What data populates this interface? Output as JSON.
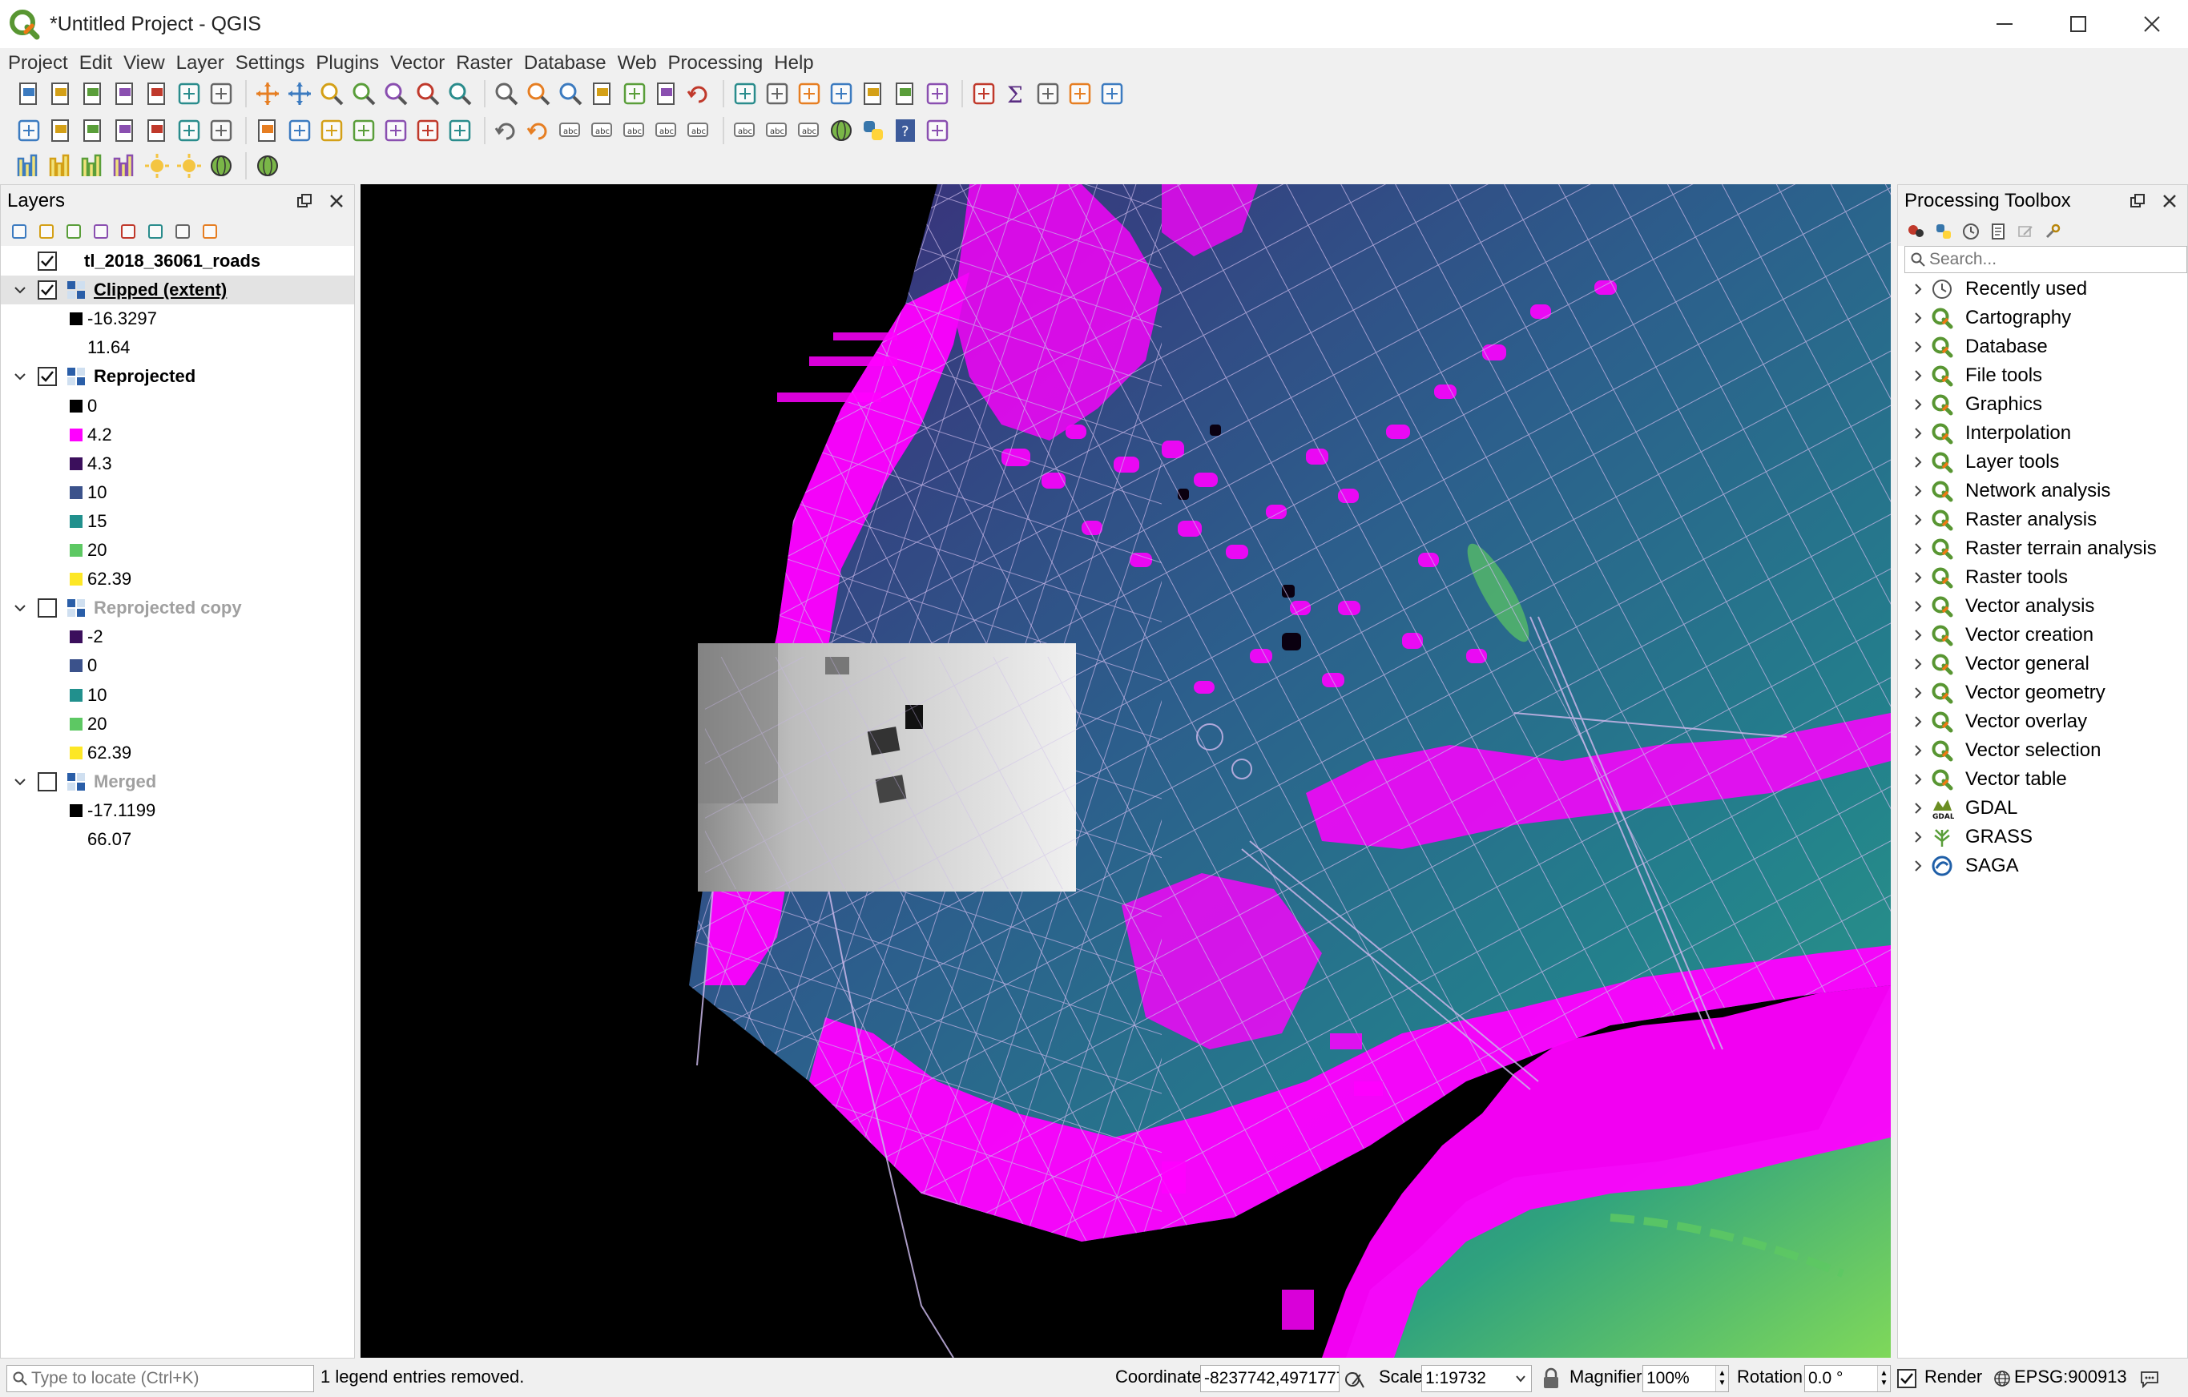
{
  "window": {
    "title": "*Untitled Project - QGIS",
    "controls": [
      "minimize",
      "maximize",
      "close"
    ]
  },
  "menubar": [
    "Project",
    "Edit",
    "View",
    "Layer",
    "Settings",
    "Plugins",
    "Vector",
    "Raster",
    "Database",
    "Web",
    "Processing",
    "Help"
  ],
  "toolbar1": [
    "new-project",
    "open-project",
    "save-project",
    "save-as",
    "new-print-layout",
    "layout-manager",
    "style-manager",
    "pan-map",
    "pan-to-selection",
    "zoom-in",
    "zoom-out",
    "zoom-native",
    "zoom-full",
    "zoom-to-selection",
    "zoom-to-layer",
    "zoom-last",
    "zoom-next",
    "new-bookmark",
    "show-bookmarks",
    "new-map-view",
    "refresh",
    "identify",
    "actions",
    "select-features",
    "deselect",
    "open-attribute-table",
    "open-field-calculator",
    "show-statistical-summary",
    "processing-toolbox",
    "statistics-sigma",
    "measure-line",
    "show-map-tips",
    "text-annotation"
  ],
  "toolbar2": [
    "data-source-manager",
    "new-geopackage",
    "new-shapefile",
    "new-spatialite",
    "new-virtual-layer",
    "current-edits",
    "toggle-editing",
    "save-edits",
    "add-feature",
    "vertex-tool",
    "delete-selected",
    "cut-features",
    "copy-features",
    "paste-features",
    "undo",
    "redo",
    "label-toolbar",
    "layer-labeling",
    "highlight-pinned",
    "pin-labels",
    "show-hide-labels",
    "move-label",
    "rotate-label",
    "change-label",
    "osm-search",
    "python-console",
    "help",
    "georeferencer"
  ],
  "toolbar3": [
    "raster-calc-1",
    "raster-calc-2",
    "raster-calc-3",
    "raster-calc-4",
    "sun-1",
    "sun-2",
    "globe-1",
    "globe-2"
  ],
  "layers_panel": {
    "title": "Layers",
    "items": [
      {
        "type": "layer",
        "name": "tl_2018_36061_roads",
        "checked": true,
        "expandable": false,
        "icon": "vector-line-icon"
      },
      {
        "type": "layer",
        "name": "Clipped (extent)",
        "checked": true,
        "expandable": true,
        "selected": true,
        "underline": true,
        "icon": "raster-icon"
      },
      {
        "type": "class",
        "swatch": "#000000",
        "label": "-16.3297"
      },
      {
        "type": "class",
        "swatch": "",
        "label": "11.64"
      },
      {
        "type": "layer",
        "name": "Reprojected",
        "checked": true,
        "expandable": true,
        "icon": "raster-icon"
      },
      {
        "type": "class",
        "swatch": "#000000",
        "label": "0"
      },
      {
        "type": "class",
        "swatch": "#ff00ff",
        "label": "4.2"
      },
      {
        "type": "class",
        "swatch": "#3b0f5c",
        "label": "4.3"
      },
      {
        "type": "class",
        "swatch": "#3b528b",
        "label": "10"
      },
      {
        "type": "class",
        "swatch": "#21908d",
        "label": "15"
      },
      {
        "type": "class",
        "swatch": "#5dc863",
        "label": "20"
      },
      {
        "type": "class",
        "swatch": "#fde725",
        "label": "62.39"
      },
      {
        "type": "layer",
        "name": "Reprojected copy",
        "checked": false,
        "expandable": true,
        "disabled": true,
        "icon": "raster-icon"
      },
      {
        "type": "class",
        "swatch": "#3b0f5c",
        "label": "-2"
      },
      {
        "type": "class",
        "swatch": "#3b528b",
        "label": "0"
      },
      {
        "type": "class",
        "swatch": "#21908d",
        "label": "10"
      },
      {
        "type": "class",
        "swatch": "#5dc863",
        "label": "20"
      },
      {
        "type": "class",
        "swatch": "#fde725",
        "label": "62.39"
      },
      {
        "type": "layer",
        "name": "Merged",
        "checked": false,
        "expandable": true,
        "disabled": true,
        "icon": "raster-icon"
      },
      {
        "type": "class",
        "swatch": "#000000",
        "label": "-17.1199"
      },
      {
        "type": "class",
        "swatch": "",
        "label": "66.07"
      }
    ]
  },
  "toolbox": {
    "title": "Processing Toolbox",
    "search_placeholder": "Search...",
    "items": [
      {
        "label": "Recently used",
        "icon": "clock-icon"
      },
      {
        "label": "Cartography",
        "icon": "qgis-icon"
      },
      {
        "label": "Database",
        "icon": "qgis-icon"
      },
      {
        "label": "File tools",
        "icon": "qgis-icon"
      },
      {
        "label": "Graphics",
        "icon": "qgis-icon"
      },
      {
        "label": "Interpolation",
        "icon": "qgis-icon"
      },
      {
        "label": "Layer tools",
        "icon": "qgis-icon"
      },
      {
        "label": "Network analysis",
        "icon": "qgis-icon"
      },
      {
        "label": "Raster analysis",
        "icon": "qgis-icon"
      },
      {
        "label": "Raster terrain analysis",
        "icon": "qgis-icon"
      },
      {
        "label": "Raster tools",
        "icon": "qgis-icon"
      },
      {
        "label": "Vector analysis",
        "icon": "qgis-icon"
      },
      {
        "label": "Vector creation",
        "icon": "qgis-icon"
      },
      {
        "label": "Vector general",
        "icon": "qgis-icon"
      },
      {
        "label": "Vector geometry",
        "icon": "qgis-icon"
      },
      {
        "label": "Vector overlay",
        "icon": "qgis-icon"
      },
      {
        "label": "Vector selection",
        "icon": "qgis-icon"
      },
      {
        "label": "Vector table",
        "icon": "qgis-icon"
      },
      {
        "label": "GDAL",
        "icon": "gdal-icon"
      },
      {
        "label": "GRASS",
        "icon": "grass-icon"
      },
      {
        "label": "SAGA",
        "icon": "saga-icon"
      }
    ]
  },
  "statusbar": {
    "locator_placeholder": "Type to locate (Ctrl+K)",
    "message": "1 legend entries removed.",
    "coordinate_label": "Coordinate",
    "coordinate_value": "-8237742,4971777",
    "scale_label": "Scale",
    "scale_value": "1:19732",
    "magnifier_label": "Magnifier",
    "magnifier_value": "100%",
    "rotation_label": "Rotation",
    "rotation_value": "0.0 °",
    "render_label": "Render",
    "render_checked": true,
    "crs": "EPSG:900913"
  },
  "colors": {
    "low": "#ff00ff",
    "viridis": [
      "#440154",
      "#3b528b",
      "#21908d",
      "#5dc863",
      "#fde725"
    ],
    "roads": "#c8b6e8",
    "background": "#000000"
  }
}
